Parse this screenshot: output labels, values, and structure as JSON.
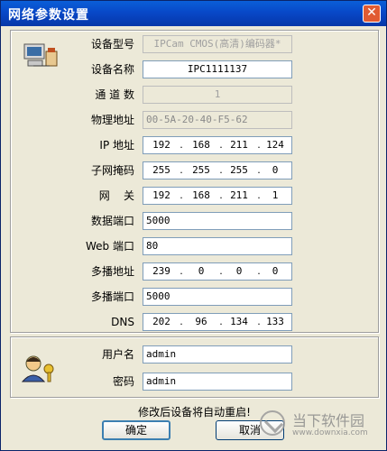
{
  "window": {
    "title": "网络参数设置",
    "close_glyph": "✕"
  },
  "network": {
    "device_model": {
      "label": "设备型号",
      "value": "IPCam CMOS(高清)编码器*"
    },
    "device_name": {
      "label": "设备名称",
      "value": "IPC1111137"
    },
    "channels": {
      "label": "通 道 数",
      "value": "1"
    },
    "mac": {
      "label": "物理地址",
      "value": "00-5A-20-40-F5-62"
    },
    "ip": {
      "label": "IP  地址",
      "octets": [
        "192",
        "168",
        "211",
        "124"
      ]
    },
    "subnet": {
      "label": "子网掩码",
      "octets": [
        "255",
        "255",
        "255",
        "0"
      ]
    },
    "gateway": {
      "label": "网    关",
      "octets": [
        "192",
        "168",
        "211",
        "1"
      ]
    },
    "data_port": {
      "label": "数据端口",
      "value": "5000"
    },
    "web_port": {
      "label": "Web 端口",
      "value": "80"
    },
    "multicast_addr": {
      "label": "多播地址",
      "octets": [
        "239",
        "0",
        "0",
        "0"
      ]
    },
    "multicast_port": {
      "label": "多播端口",
      "value": "5000"
    },
    "dns": {
      "label": "DNS",
      "octets": [
        "202",
        "96",
        "134",
        "133"
      ]
    }
  },
  "account": {
    "username": {
      "label": "用户名",
      "value": "admin"
    },
    "password": {
      "label": "密码",
      "value": "admin"
    }
  },
  "footer": {
    "note": "修改后设备将自动重启!",
    "ok_label": "确定",
    "cancel_label": "取消"
  },
  "watermark": {
    "main": "当下软件园",
    "sub": "www.downxia.com"
  },
  "icons": {
    "network": "computer-phone-icon",
    "user": "user-key-icon"
  }
}
